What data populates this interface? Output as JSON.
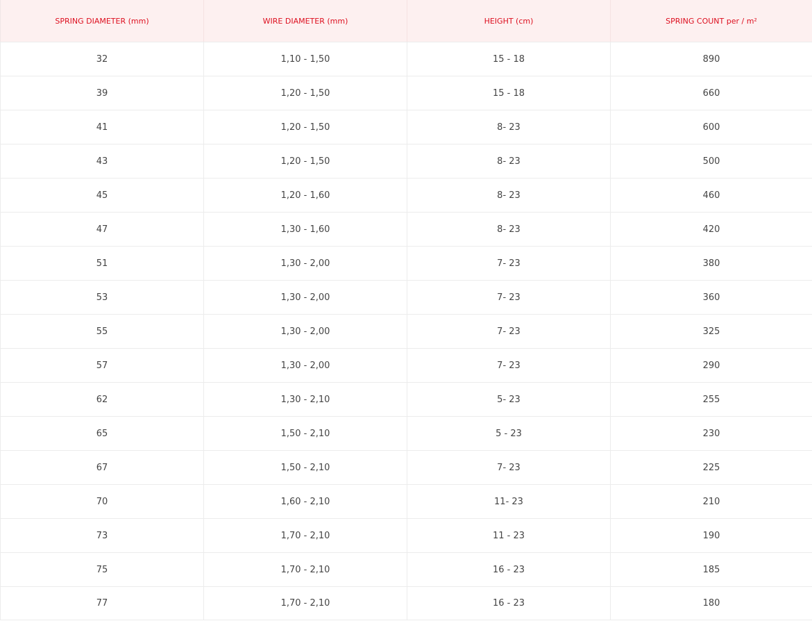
{
  "table": {
    "headers": [
      "SPRING DIAMETER (mm)",
      "WIRE DIAMETER (mm)",
      "HEIGHT (cm)",
      "SPRING COUNT per / m²"
    ],
    "rows": [
      [
        "32",
        "1,10 - 1,50",
        "15 - 18",
        "890"
      ],
      [
        "39",
        "1,20 - 1,50",
        "15 - 18",
        "660"
      ],
      [
        "41",
        "1,20 - 1,50",
        "8- 23",
        "600"
      ],
      [
        "43",
        "1,20 - 1,50",
        "8- 23",
        "500"
      ],
      [
        "45",
        "1,20 - 1,60",
        "8- 23",
        "460"
      ],
      [
        "47",
        "1,30 - 1,60",
        "8- 23",
        "420"
      ],
      [
        "51",
        "1,30 - 2,00",
        "7- 23",
        "380"
      ],
      [
        "53",
        "1,30 - 2,00",
        "7- 23",
        "360"
      ],
      [
        "55",
        "1,30 - 2,00",
        "7- 23",
        "325"
      ],
      [
        "57",
        "1,30 - 2,00",
        "7- 23",
        "290"
      ],
      [
        "62",
        "1,30 - 2,10",
        "5- 23",
        "255"
      ],
      [
        "65",
        "1,50 - 2,10",
        "5 - 23",
        "230"
      ],
      [
        "67",
        "1,50 - 2,10",
        "7- 23",
        "225"
      ],
      [
        "70",
        "1,60 - 2,10",
        "11- 23",
        "210"
      ],
      [
        "73",
        "1,70 - 2,10",
        "11 - 23",
        "190"
      ],
      [
        "75",
        "1,70 - 2,10",
        "16 - 23",
        "185"
      ],
      [
        "77",
        "1,70 - 2,10",
        "16 - 23",
        "180"
      ]
    ]
  },
  "colors": {
    "header_text": "#dd0f1f",
    "header_background": "#fdf0f0",
    "cell_text": "#444444",
    "border": "#ececec"
  }
}
